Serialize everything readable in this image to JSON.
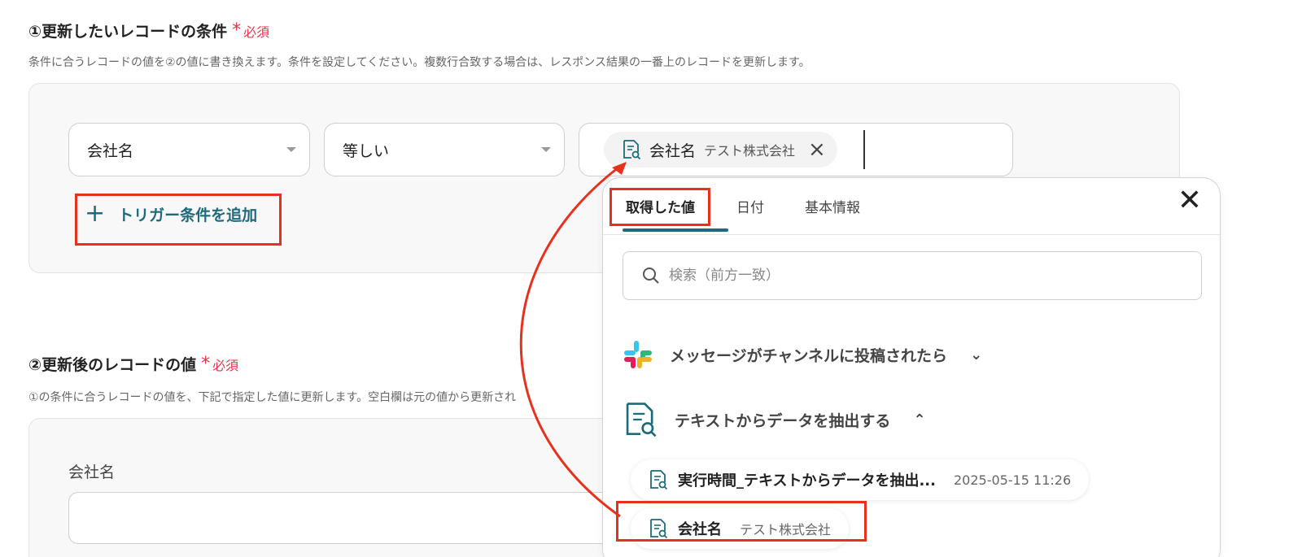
{
  "section1": {
    "title": "①更新したいレコードの条件",
    "required": "必須",
    "description": "条件に合うレコードの値を②の値に書き換えます。条件を設定してください。複数行合致する場合は、レスポンス結果の一番上のレコードを更新します。"
  },
  "condition": {
    "field": "会社名",
    "operator": "等しい",
    "chip_name": "会社名",
    "chip_value": "テスト株式会社"
  },
  "add_condition_label": "トリガー条件を追加",
  "section2": {
    "title": "②更新後のレコードの値",
    "required": "必須",
    "description": "①の条件に合うレコードの値を、下記で指定した値に更新します。空白欄は元の値から更新され",
    "field_label": "会社名"
  },
  "dropdown": {
    "tabs": [
      "取得した値",
      "日付",
      "基本情報"
    ],
    "search_placeholder": "検索（前方一致）",
    "groups": [
      {
        "label": "メッセージがチャンネルに投稿されたら",
        "icon": "slack-icon",
        "expanded": false
      },
      {
        "label": "テキストからデータを抽出する",
        "icon": "doc-search-icon",
        "expanded": true
      }
    ],
    "items": [
      {
        "name": "実行時間_テキストからデータを抽出...",
        "value": "2025-05-15 11:26"
      },
      {
        "name": "会社名",
        "value": "テスト株式会社"
      }
    ]
  },
  "colors": {
    "accent": "#1e6a7d",
    "required": "#e8334a",
    "highlight": "#e8311d"
  }
}
